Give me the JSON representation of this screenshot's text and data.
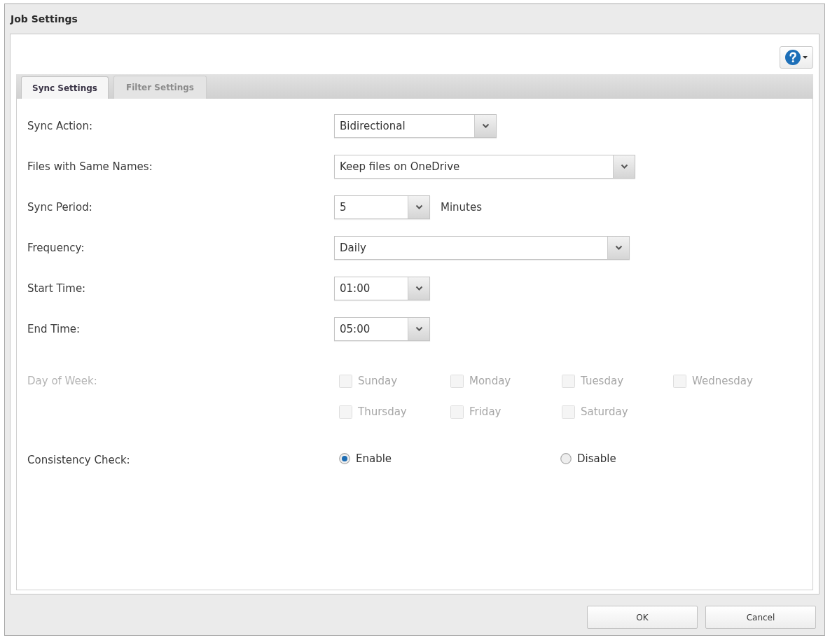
{
  "window": {
    "title": "Job Settings"
  },
  "tabs": [
    {
      "label": "Sync Settings",
      "selected": true
    },
    {
      "label": "Filter Settings",
      "selected": false
    }
  ],
  "rows": [
    {
      "kind": "select",
      "label": "Sync Action:",
      "value": "Bidirectional"
    },
    {
      "kind": "select",
      "label": "Files with Same Names:",
      "value": "Keep files on OneDrive"
    },
    {
      "kind": "select",
      "label": "Sync Period:",
      "value": "5",
      "unit": "Minutes"
    },
    {
      "kind": "select",
      "label": "Frequency:",
      "value": "Daily"
    },
    {
      "kind": "select",
      "label": "Start Time:",
      "value": "01:00"
    },
    {
      "kind": "select",
      "label": "End Time:",
      "value": "05:00"
    },
    {
      "kind": "checkboxes",
      "label": "Day of Week:",
      "disabled": true,
      "options": [
        {
          "label": "Sunday",
          "checked": false
        },
        {
          "label": "Monday",
          "checked": false
        },
        {
          "label": "Tuesday",
          "checked": false
        },
        {
          "label": "Wednesday",
          "checked": false
        },
        {
          "label": "Thursday",
          "checked": false
        },
        {
          "label": "Friday",
          "checked": false
        },
        {
          "label": "Saturday",
          "checked": false
        }
      ]
    },
    {
      "kind": "radio",
      "label": "Consistency Check:",
      "options": [
        {
          "label": "Enable",
          "selected": true
        },
        {
          "label": "Disable",
          "selected": false
        }
      ]
    }
  ],
  "buttons": [
    {
      "label": "OK"
    },
    {
      "label": "Cancel"
    }
  ]
}
